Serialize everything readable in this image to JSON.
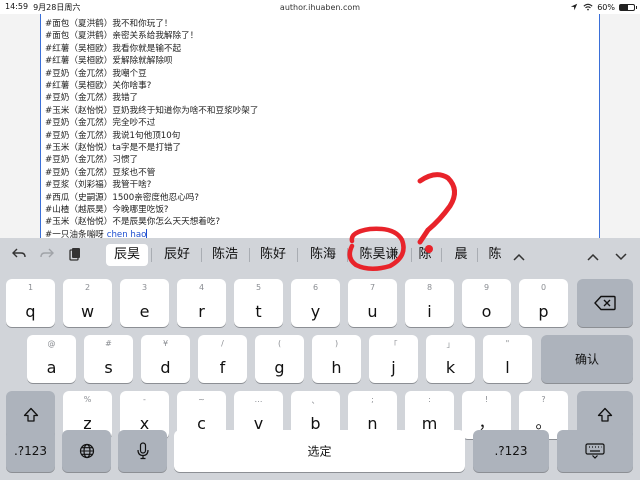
{
  "status_bar": {
    "time": "14:59",
    "date": "9月28日周六",
    "url": "author.ihuaben.com",
    "battery_text": "60%",
    "battery_level": 0.6,
    "signal_icon": "wifi-icon",
    "arrow_icon": "location-arrow-icon"
  },
  "document": {
    "lines": [
      "#面包（夏洪鹤）我不和你玩了！",
      "#面包（夏洪鹤）亲密关系给我解除了！",
      "#红薯（吴桓欧）我看你就是输不起",
      "#红薯（吴桓欧）爱解除就解除呗",
      "#豆奶（金兀然）我嘲个豆",
      "#红薯（吴桓欧）关你啥事?",
      "#豆奶（金兀然）我错了",
      "#玉米（赵怡悦）豆奶我终于知道你为啥不和豆浆吵架了",
      "#豆奶（金兀然）完全吵不过",
      "#豆奶（金兀然）我说1句他顶10句",
      "#玉米（赵怡悦）ta字是不是打错了",
      "#豆奶（金兀然）习惯了",
      "#豆奶（金兀然）豆浆也不管",
      "#豆浆（刘彩福）我管干啥?",
      "#西瓜（史嗣源）1500亲密度他忍心吗?",
      "#山楂（越辰昊）今晚哪里吃饭?",
      "#玉米（赵怡悦）不是辰昊你怎么天天想着吃?"
    ],
    "current_line_prefix": "#一只油条嘣呀",
    "composing_text": "chen hao"
  },
  "candidates": {
    "undo_icon": "undo-icon",
    "redo_icon": "redo-icon",
    "paste_icon": "clipboard-icon",
    "items": [
      "辰昊",
      "辰好",
      "陈浩",
      "陈好",
      "陈海",
      "陈昊谦",
      "陈",
      "晨",
      "陈"
    ],
    "expand_icon": "chevron-up-icon",
    "nav_up_icon": "chevron-up-icon",
    "nav_down_icon": "chevron-down-icon"
  },
  "keyboard": {
    "row1": [
      {
        "main": "q",
        "alt": "1"
      },
      {
        "main": "w",
        "alt": "2"
      },
      {
        "main": "e",
        "alt": "3"
      },
      {
        "main": "r",
        "alt": "4"
      },
      {
        "main": "t",
        "alt": "5"
      },
      {
        "main": "y",
        "alt": "6"
      },
      {
        "main": "u",
        "alt": "7"
      },
      {
        "main": "i",
        "alt": "8"
      },
      {
        "main": "o",
        "alt": "9"
      },
      {
        "main": "p",
        "alt": "0"
      }
    ],
    "row2": [
      {
        "main": "a",
        "alt": "@"
      },
      {
        "main": "s",
        "alt": "#"
      },
      {
        "main": "d",
        "alt": "¥"
      },
      {
        "main": "f",
        "alt": "/"
      },
      {
        "main": "g",
        "alt": "("
      },
      {
        "main": "h",
        "alt": ")"
      },
      {
        "main": "j",
        "alt": "「"
      },
      {
        "main": "k",
        "alt": "」"
      },
      {
        "main": "l",
        "alt": "\""
      }
    ],
    "row3": [
      {
        "main": "z",
        "alt": "%"
      },
      {
        "main": "x",
        "alt": "-"
      },
      {
        "main": "c",
        "alt": "~"
      },
      {
        "main": "v",
        "alt": "…"
      },
      {
        "main": "b",
        "alt": "、"
      },
      {
        "main": "n",
        "alt": ";"
      },
      {
        "main": "m",
        "alt": ":"
      },
      {
        "main": "，",
        "alt": "!"
      },
      {
        "main": "。",
        "alt": "?"
      }
    ],
    "confirm_label": "确认",
    "space_label": "选定",
    "numbers_label": ".?123",
    "delete_icon": "delete-icon",
    "shift_icon": "shift-icon",
    "globe_icon": "globe-icon",
    "mic_icon": "microphone-icon",
    "hide_icon": "keyboard-hide-icon"
  },
  "annotation": {
    "color": "#e8232a",
    "shape": "hand-drawn question mark circling a candidate"
  }
}
